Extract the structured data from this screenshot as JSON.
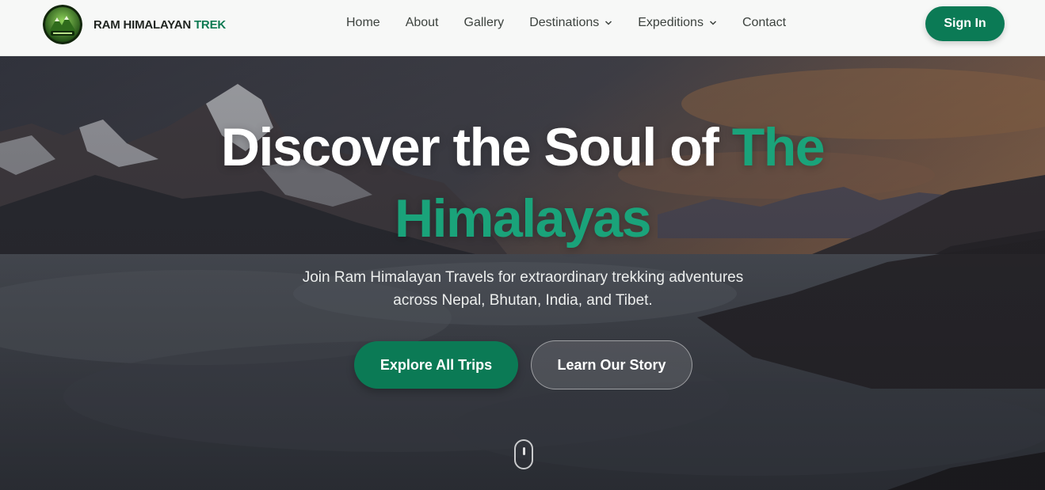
{
  "brand": {
    "name": "RAM HIMALAYAN",
    "accent": "TREK",
    "logo_icon": "mountain-logo-icon",
    "accent_color": "#0d7a52"
  },
  "nav": {
    "items": [
      {
        "label": "Home"
      },
      {
        "label": "About"
      },
      {
        "label": "Gallery"
      },
      {
        "label": "Destinations",
        "has_dropdown": true
      },
      {
        "label": "Expeditions",
        "has_dropdown": true
      },
      {
        "label": "Contact"
      }
    ],
    "dropdown_icon": "chevron-down-icon"
  },
  "auth": {
    "signin_label": "Sign In"
  },
  "hero": {
    "headline_part1": "Discover the Soul of",
    "headline_accent_line1": "The",
    "headline_accent_line2": "Himalayas",
    "subtitle_line1": "Join Ram Himalayan Travels for extraordinary trekking adventures",
    "subtitle_line2": "across Nepal, Bhutan, India, and Tibet.",
    "primary_cta": "Explore All Trips",
    "secondary_cta": "Learn Our Story",
    "scroll_icon": "mouse-scroll-icon"
  },
  "colors": {
    "primary": "#0b7a55",
    "accent_text": "#1aa37a",
    "navbar_bg": "#f7f8f7"
  }
}
